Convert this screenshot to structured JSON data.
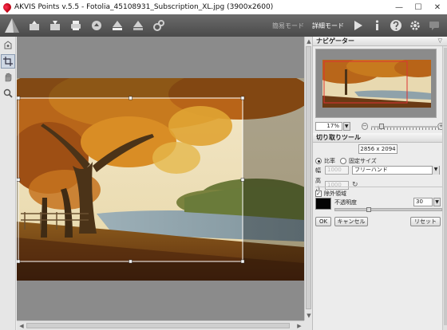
{
  "window": {
    "title": "AKVIS Points v.5.5 - Fotolia_45108931_Subscription_XL.jpg (3900x2600)",
    "minimize": "—",
    "maximize": "☐",
    "close": "✕"
  },
  "toolbar": {
    "icons": [
      "open-icon",
      "save-icon",
      "print-icon",
      "share-icon",
      "settings-gear-icon"
    ],
    "mode_simple": "簡易モード",
    "mode_advanced": "詳細モード",
    "right_icons": [
      "run-icon",
      "info-icon",
      "help-icon",
      "settings-icon",
      "chat-icon"
    ]
  },
  "left_tools": [
    "hand-tool-icon",
    "crop-tool-icon",
    "pan-icon",
    "zoom-icon"
  ],
  "navigator": {
    "title": "ナビゲーター",
    "zoom_value": "17%",
    "zoom_minus": "−",
    "zoom_plus": "+",
    "zoom_level": 0.12
  },
  "crop_tool": {
    "title": "切り取りツール",
    "dimensions": "2856 x 2094",
    "ratio_label": "比率",
    "fixed_size_label": "固定サイズ",
    "width_label": "幅",
    "width_value": "1000",
    "height_label": "高さ",
    "height_value": "1000",
    "preset": "フリーハンド",
    "exclude_area_label": "除外領域",
    "exclude_checked": "✓",
    "opacity_label": "不透明度",
    "opacity_value": "30",
    "opacity_level": 0.3,
    "ok_label": "OK",
    "cancel_label": "キャンセル",
    "reset_label": "リセット"
  },
  "colors": {
    "toolbar_bg": "#4a4a4a",
    "canvas_bg": "#8b8b8b",
    "shade_color": "#050505"
  }
}
